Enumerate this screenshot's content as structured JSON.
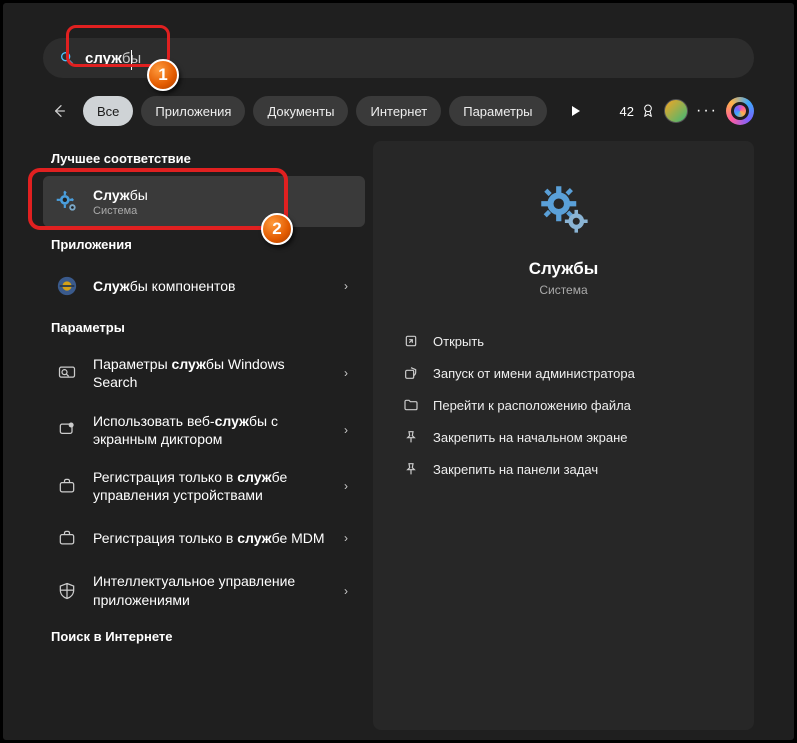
{
  "search": {
    "typed": "служ",
    "suggest": "бы"
  },
  "annotations": {
    "marker1": "1",
    "marker2": "2"
  },
  "filters": {
    "all": "Все",
    "apps": "Приложения",
    "docs": "Документы",
    "web": "Интернет",
    "settings": "Параметры"
  },
  "rewards": {
    "points": "42"
  },
  "sections": {
    "best": "Лучшее соответствие",
    "apps": "Приложения",
    "settings": "Параметры",
    "web": "Поиск в Интернете"
  },
  "bestMatch": {
    "title_pre": "Служ",
    "title_post": "бы",
    "sub": "Система"
  },
  "appsList": [
    {
      "pre": "Служ",
      "post": "бы компонентов"
    }
  ],
  "settingsList": [
    {
      "text_a": "Параметры ",
      "bold": "служ",
      "text_b": "бы Windows Search"
    },
    {
      "text_a": "Использовать веб-",
      "bold": "служ",
      "text_b": "бы с экранным диктором"
    },
    {
      "text_a": "Регистрация только в ",
      "bold": "служ",
      "text_b": "бе управления устройствами"
    },
    {
      "text_a": "Регистрация только в ",
      "bold": "служ",
      "text_b": "бе MDM"
    },
    {
      "text_a": "Интеллектуальное управление приложениями",
      "bold": "",
      "text_b": ""
    }
  ],
  "detail": {
    "title": "Службы",
    "sub": "Система",
    "actions": {
      "open": "Открыть",
      "admin": "Запуск от имени администратора",
      "location": "Перейти к расположению файла",
      "pinStart": "Закрепить на начальном экране",
      "pinTaskbar": "Закрепить на панели задач"
    }
  }
}
